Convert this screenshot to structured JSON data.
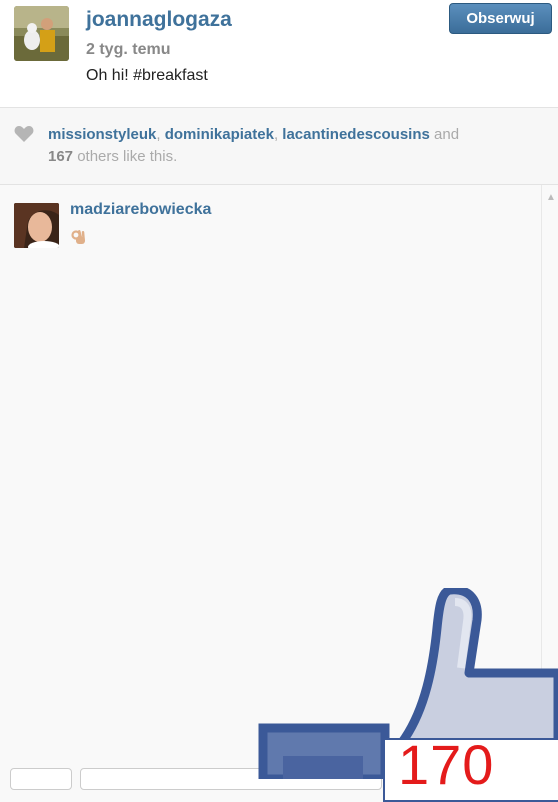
{
  "post": {
    "username": "joannaglogaza",
    "timestamp": "2 tyg. temu",
    "caption": "Oh hi! #breakfast",
    "follow_label": "Obserwuj"
  },
  "likes": {
    "user1": "missionstyleuk",
    "sep1": ", ",
    "user2": "dominikapiatek",
    "sep2": ", ",
    "user3": "lacantinedescousins",
    "and": " and",
    "count": "167",
    "others": " others like this."
  },
  "comments": [
    {
      "username": "madziarebowiecka",
      "icon": "ok-hand-emoji"
    }
  ],
  "overlay": {
    "icon": "thumbs-up-icon",
    "count": "170"
  },
  "colors": {
    "link": "#3f729b",
    "button": "#3b6d99",
    "overlay_blue": "#3b5998",
    "overlay_red": "#e41b1b"
  }
}
